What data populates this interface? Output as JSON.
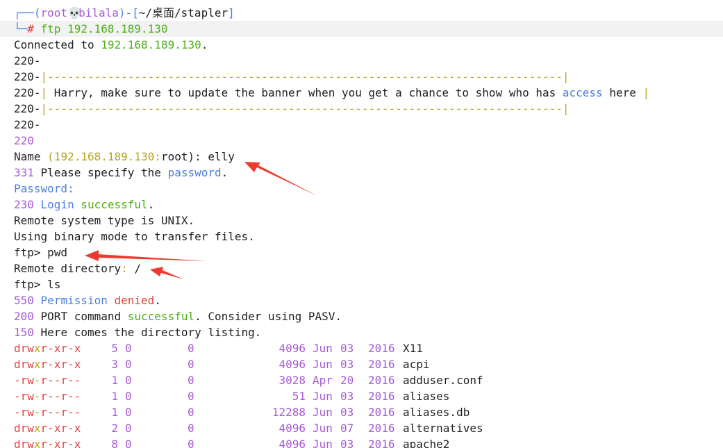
{
  "prompt": {
    "open": "┌──(",
    "user": "root",
    "skull": "💀",
    "host": "bilala",
    "mid": ")-[",
    "path": "~/桌面/stapler",
    "close": "]",
    "line2_prefix": "└─",
    "hash": "#",
    "command": " ftp 192.168.189.130"
  },
  "session": {
    "connected_prefix": "Connected to ",
    "connected_ip": "192.168.189.130",
    "connected_dot": ".",
    "banner_220_1": "220-",
    "banner_code": "220-",
    "banner_border": "|-----------------------------------------------------------------------------|",
    "banner_code_msg": "220-",
    "banner_pipe_open": "| ",
    "banner_msg_a": "Harry, make sure to update the banner when you get a chance to show who has ",
    "banner_access": "access",
    "banner_msg_b": " here ",
    "banner_pipe_close": "|",
    "banner_220_end_dash": "220-",
    "banner_220_end": "220",
    "name_label": "Name ",
    "name_paren": "(192.168.189.130:",
    "name_root": "root",
    "name_close": "): elly",
    "pass_code": "331",
    "pass_text_a": " Please specify the ",
    "pass_word": "password",
    "pass_text_b": ".",
    "password_label": "Password:",
    "login_code": "230",
    "login_word": " Login ",
    "login_success": "successful",
    "login_dot": ".",
    "system_type": "Remote system type is UNIX.",
    "binary_mode": "Using binary mode to transfer files.",
    "ftp_prompt": "ftp>",
    "cmd_pwd": " pwd",
    "remote_dir_label": "Remote directory",
    "remote_dir_colon": ":",
    "remote_dir_value": " /",
    "cmd_ls": " ls",
    "perm_code": "550",
    "perm_word": " Permission",
    "perm_denied": " denied",
    "perm_dot": ".",
    "port_code": "200",
    "port_text_a": " PORT command ",
    "port_success": "successful",
    "port_text_b": ". Consider using PASV.",
    "here_code": "150",
    "here_text": " Here comes the directory listing."
  },
  "listing": [
    {
      "perm_d": "drw",
      "perm_x": "x",
      "perm_rest": "r-xr-x",
      "links": "5",
      "owner": "0",
      "group": "0",
      "size": "4096",
      "month": "Jun",
      "day": "03",
      "year": "2016",
      "name": "X11"
    },
    {
      "perm_d": "drw",
      "perm_x": "x",
      "perm_rest": "r-xr-x",
      "links": "3",
      "owner": "0",
      "group": "0",
      "size": "4096",
      "month": "Jun",
      "day": "03",
      "year": "2016",
      "name": "acpi"
    },
    {
      "perm_d": "-rw",
      "perm_x": "-",
      "perm_rest": "r--r--",
      "links": "1",
      "owner": "0",
      "group": "0",
      "size": "3028",
      "month": "Apr",
      "day": "20",
      "year": "2016",
      "name": "adduser.conf"
    },
    {
      "perm_d": "-rw",
      "perm_x": "-",
      "perm_rest": "r--r--",
      "links": "1",
      "owner": "0",
      "group": "0",
      "size": "51",
      "month": "Jun",
      "day": "03",
      "year": "2016",
      "name": "aliases"
    },
    {
      "perm_d": "-rw",
      "perm_x": "-",
      "perm_rest": "r--r--",
      "links": "1",
      "owner": "0",
      "group": "0",
      "size": "12288",
      "month": "Jun",
      "day": "03",
      "year": "2016",
      "name": "aliases.db"
    },
    {
      "perm_d": "drw",
      "perm_x": "x",
      "perm_rest": "r-xr-x",
      "links": "2",
      "owner": "0",
      "group": "0",
      "size": "4096",
      "month": "Jun",
      "day": "07",
      "year": "2016",
      "name": "alternatives"
    },
    {
      "perm_d": "drw",
      "perm_x": "x",
      "perm_rest": "r-xr-x",
      "links": "8",
      "owner": "0",
      "group": "0",
      "size": "4096",
      "month": "Jun",
      "day": "03",
      "year": "2016",
      "name": "apache2"
    }
  ],
  "colors": {
    "red": "#e0443e",
    "purple": "#a45ad6",
    "olive": "#b6a31b",
    "green": "#4caf1a",
    "blue": "#4c7ee0",
    "text": "#1f1f1f",
    "highlight": "#f2f2f2",
    "annotation_arrow": "#ee3a2e"
  },
  "icons": {
    "skull": "skull-icon",
    "arrow": "annotation-arrow-icon"
  }
}
